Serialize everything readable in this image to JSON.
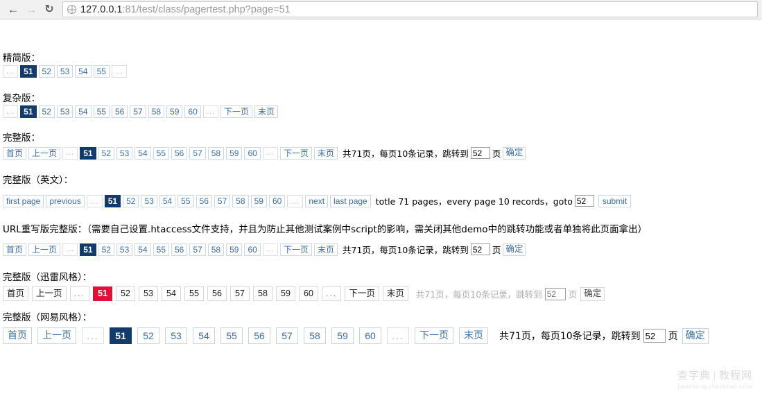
{
  "browser": {
    "back_icon": "back-arrow-icon",
    "forward_icon": "forward-arrow-icon",
    "reload_icon": "reload-icon",
    "page_icon": "globe-icon",
    "url_host": "127.0.0.1",
    "url_path": ":81/test/class/pagertest.php?page=51"
  },
  "sections": {
    "simple": {
      "heading": "精简版：",
      "items": [
        "...",
        "51",
        "52",
        "53",
        "54",
        "55",
        "..."
      ],
      "current": "51"
    },
    "complex": {
      "heading": "复杂版：",
      "items": [
        "...",
        "51",
        "52",
        "53",
        "54",
        "55",
        "56",
        "57",
        "58",
        "59",
        "60",
        "...",
        "下一页",
        "末页"
      ],
      "current": "51"
    },
    "full": {
      "heading": "完整版：",
      "items": [
        "首页",
        "上一页",
        "...",
        "51",
        "52",
        "53",
        "54",
        "55",
        "56",
        "57",
        "58",
        "59",
        "60",
        "...",
        "下一页",
        "末页"
      ],
      "current": "51",
      "info_prefix": "共71页，每页10条记录，跳转到",
      "jump_value": "52",
      "info_suffix": "页",
      "confirm_label": "确定"
    },
    "full_en": {
      "heading": "完整版（英文）：",
      "items": [
        "first page",
        "previous",
        "...",
        "51",
        "52",
        "53",
        "54",
        "55",
        "56",
        "57",
        "58",
        "59",
        "60",
        "...",
        "next",
        "last page"
      ],
      "current": "51",
      "info_prefix": "totle 71 pages，every page 10 records，goto",
      "jump_value": "52",
      "info_suffix": "",
      "confirm_label": "submit"
    },
    "url_rewrite": {
      "heading": "URL重写版完整版：（需要自己设置.htaccess文件支持，并且为防止其他测试案例中script的影响，需关闭其他demo中的跳转功能或者单独将此页面拿出）",
      "items": [
        "首页",
        "上一页",
        "...",
        "51",
        "52",
        "53",
        "54",
        "55",
        "56",
        "57",
        "58",
        "59",
        "60",
        "...",
        "下一页",
        "末页"
      ],
      "current": "51",
      "info_prefix": "共71页，每页10条记录，跳转到",
      "jump_value": "52",
      "info_suffix": "页",
      "confirm_label": "确定"
    },
    "xunlei": {
      "heading": "完整版（迅雷风格）：",
      "items": [
        "首页",
        "上一页",
        "...",
        "51",
        "52",
        "53",
        "54",
        "55",
        "56",
        "57",
        "58",
        "59",
        "60",
        "...",
        "下一页",
        "末页"
      ],
      "current": "51",
      "info_prefix": "共71页，每页10条记录，跳转到",
      "jump_value": "52",
      "info_suffix": "页",
      "confirm_label": "确定"
    },
    "netease": {
      "heading": "完整版（网易风格）：",
      "items": [
        "首页",
        "上一页",
        "...",
        "51",
        "52",
        "53",
        "54",
        "55",
        "56",
        "57",
        "58",
        "59",
        "60",
        "...",
        "下一页",
        "末页"
      ],
      "current": "51",
      "info_prefix": "共71页，每页10条记录，跳转到",
      "jump_value": "52",
      "info_suffix": "页",
      "confirm_label": "确定"
    }
  },
  "watermark": {
    "name": "查字典",
    "separator": "|",
    "name2": "教程网",
    "site": "jiaocheng.chazidian.com"
  },
  "colors": {
    "current_blue": "#123a6b",
    "current_red": "#e2113a",
    "link_blue": "#3a6ea5",
    "dots_gray": "#b9b9b9"
  }
}
